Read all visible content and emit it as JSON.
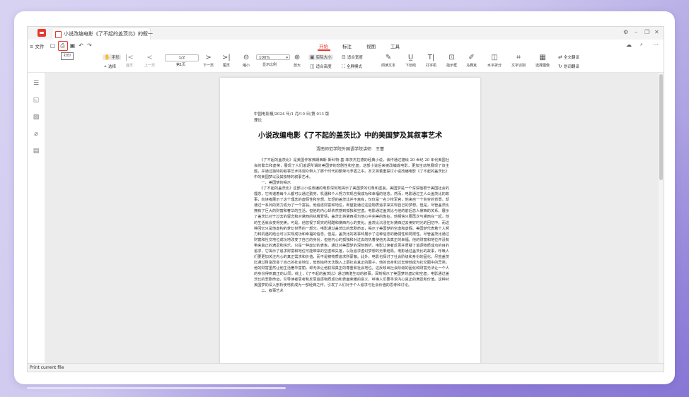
{
  "titlebar": {
    "tab_title": "小说改编电影《了不起的盖茨比》的叙一",
    "tab_close": "×",
    "controls": [
      "⚙",
      "–",
      "❐",
      "✕"
    ]
  },
  "toolbar": {
    "menu_label": "≡ 文件",
    "print_tooltip": "打印",
    "ribbon_tabs": [
      "开始",
      "标注",
      "视图",
      "工具"
    ],
    "active_tab": "开始",
    "right_icons": [
      "☁",
      "🔍",
      "⋯"
    ],
    "tools": {
      "select_hand": "手形",
      "select": "选择",
      "first_page": "首页",
      "prev_page": "上一页",
      "page_input": "1/2",
      "page_label": "第1页",
      "next_page": "下一页",
      "last_page": "尾页",
      "zoom_out": "缩小",
      "zoom_value": "100%",
      "zoom_label": "显示比例",
      "zoom_in": "放大",
      "actual_size": "实际大小",
      "fit_width": "适合宽度",
      "fit_height": "适合高度",
      "fullscreen": "全屏模式",
      "read_text": "阅读文本",
      "underline": "下划线",
      "typewriter": "打字机",
      "annotate_box": "指示框",
      "marker": "马赛克",
      "split": "水平拆分",
      "ocr": "文字识别",
      "select_image": "选择图像",
      "translate_full": "全文翻译",
      "translate_word": "划词翻译"
    }
  },
  "document": {
    "meta_line": "中国电影报/2024 年/1 月/10 日/第 013 版",
    "meta_line2": "理论",
    "title": "小说改编电影《了不起的盖茨比》中的美国梦及其叙事艺术",
    "author": "渭南师范学院外国语学院讲师　王蕾",
    "para1": "　　《了不起的盖茨比》是美国作家弗朗西斯·斯科特·基·菲茨杰拉德的经典小说，该作通过描绘 20 世纪 20 年代美国社会的繁华和虚荣，展现了人们追逐所谓的美国梦的悲剧性和空虚。这部小说后来被改编成电影，更加生动地展现了该主题，并通过独特的叙事艺术将观众带入了那个时代的繁荣与矛盾之中。本文将着重探讨小说改编电影《了不起的盖茨比》中的美国梦以及其独特的叙事艺术。",
    "section1": "　　一、美国梦的揭示",
    "para2": "　　《了不起的盖茨比》这部以小说改编的电影深刻地揭示了美国梦的幻象和虚妄。美国梦是一个深深植根于美国社会的理念，它传递着每个人都可以通过勤劳、机遇和个人努力实现自我成功和幸福的信念。然而，电影通过主人公盖茨比的故事，向读者展示了这个理念的虚假性和空想。年轻的盖茨比并不富有，仅仅是一名少校军官，他来自一个贫穷的背景，却通过一系列的努力成为了一个富翁。他追逐财富和地位，希望能通过这些物质追求来实现自己的梦想。但是，尽管盖茨比拥有了巨大的财富和奢华的生活，但他的内心却依然感到孤独和空虚。电影通过盖茨比与他的前后恋人黛西的关系，展示了盖茨比对于过去的留恋和对黛西的执着爱情，盖茨比将黛西视为他心中完美的象征，他相信只要再次与黛西在一起，他的生活就会变得完美。可是，他忽视了现实的残酷和黛西内心的变化。盖茨比沉浸在对黛西过去美好时光的回忆中，而这种回忆只是他虚构的梦幻世界的一部分。电影通过盖茨比的悲剧命运，揭示了美国梦的空虚和虚假。美国梦代表着个人努力和机遇的结合可以实现成功和幸福的信念。但是，盖茨比的故事却展示了这种信念的脆弱性和局限性。尽管盖茨比通过财富和社交地位成功地改变了自己的身份，但他内心的孤独和对过去的执着使他无法真正的幸福。他的财富和地位并没有带来真正的满足和快乐，只是一种虚幻的表象。通过对美国梦的深刻剖析，电影让读者反思并质疑了追逐物质成功的目的追求，它揭示了追求财富和地位可能带来的空虚和失落，以及追求虚幻梦想的无果结局。电影通过盖茨比的故事，呼唤人们要更加关注内心的真正需求和价值，而不是被物质追求所蒙蔽。此外，电影也探讨了社会阶级和身份的固化。尽管盖茨比通过财富改变了自己的社会地位，但他始终无法融入上层社会真正的圈子。他的出身和过去使他成为社交圈中的异类，他的财富虽然让他生活奢华富丽，却无法让他获得真正的尊重和社会地位。这反映出社会阶级的固化和财富无法让一个人的身份得到真正的认同。综上，《了不起的盖茨比》通过精湛生动的叙事，深刻揭示了美国梦的虚幻和空虚。电影通过盖茨比的悲剧命运，引导读者思考和反思追逐物质成功和表面荣耀的意义，呼唤人们要寻求内心真正的满足和价值。这种对美国梦的深入剖析使电影成为一部经典之作，引发了人们对于个人追求与社会价值的思考和讨论。",
    "section2": "　　二、叙事艺术"
  },
  "sidebar_icons": [
    "list-icon",
    "bookmark-icon",
    "thumbnail-icon",
    "attachment-icon",
    "page-icon"
  ],
  "status": {
    "text": "Print current file"
  }
}
